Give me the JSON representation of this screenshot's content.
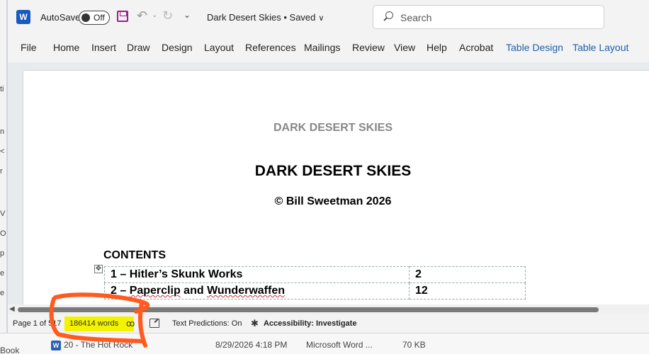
{
  "titlebar": {
    "autosave_label": "AutoSave",
    "autosave_state": "Off",
    "document_title": "Dark Desert Skies • Saved",
    "search_placeholder": "Search"
  },
  "ribbon": {
    "tabs": [
      "File",
      "Home",
      "Insert",
      "Draw",
      "Design",
      "Layout",
      "References",
      "Mailings",
      "Review",
      "View",
      "Help",
      "Acrobat",
      "Table Design",
      "Table Layout"
    ]
  },
  "document": {
    "header_text": "DARK DESERT SKIES",
    "title": "DARK DESERT SKIES",
    "author_line": "© Bill Sweetman 2026",
    "contents_heading": "CONTENTS",
    "toc": [
      {
        "title": "1 – Hitler’s Skunk Works",
        "page": "2"
      },
      {
        "title_prefix": "2 – ",
        "title_word1": "Paperclip",
        "title_mid": " and ",
        "title_word2": "Wunderwaffen",
        "page": "12"
      }
    ]
  },
  "statusbar": {
    "page": "Page 1 of 517",
    "words": "186414 words",
    "text_predictions": "Text Predictions: On",
    "accessibility": "Accessibility: Investigate"
  },
  "background_explorer": {
    "file_name": "20 - The Hot Rock",
    "modified": "8/29/2026 4:18 PM",
    "type": "Microsoft Word ...",
    "size": "70 KB",
    "book_label": "Book"
  },
  "colors": {
    "accent_context_tab": "#1f5fa8",
    "word_blue": "#185abd",
    "highlight": "#f3f300",
    "annotation": "#ff5a1f"
  }
}
